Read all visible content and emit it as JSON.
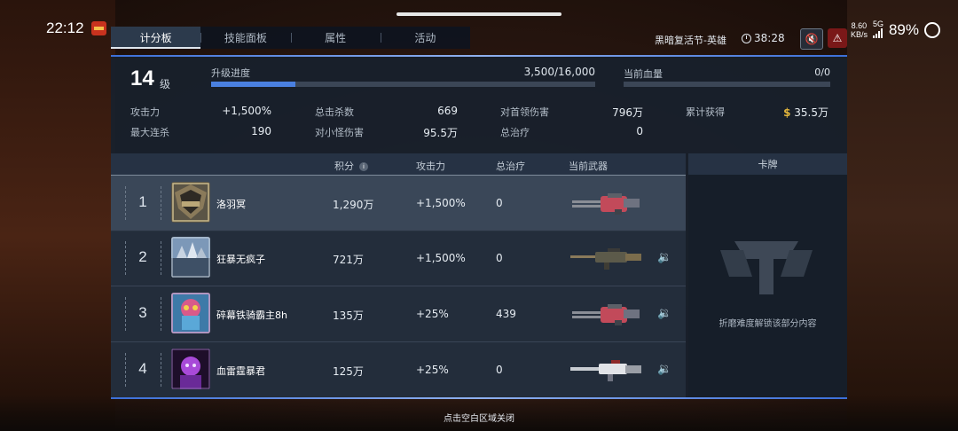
{
  "status_bar": {
    "time": "22:12",
    "net_speed_value": "8.60",
    "net_speed_unit": "KB/s",
    "network": "5G",
    "battery": "89%"
  },
  "tabs": [
    {
      "label": "计分板",
      "active": true
    },
    {
      "label": "技能面板",
      "active": false
    },
    {
      "label": "属性",
      "active": false
    },
    {
      "label": "活动",
      "active": false
    }
  ],
  "mode": "黑暗复活节-英雄",
  "timer": "38:28",
  "player": {
    "level": "14",
    "level_unit": "级",
    "upgrade_label": "升级进度",
    "upgrade_value": "3,500/16,000",
    "upgrade_progress": 0.219,
    "hp_label": "当前血量",
    "hp_value": "0/0"
  },
  "stats": [
    {
      "label": "攻击力",
      "value": "+1,500%"
    },
    {
      "label": "总击杀数",
      "value": "669"
    },
    {
      "label": "对首领伤害",
      "value": "796万"
    },
    {
      "label": "累计获得",
      "value": "35.5万"
    },
    {
      "label": "最大连杀",
      "value": "190"
    },
    {
      "label": "对小怪伤害",
      "value": "95.5万"
    },
    {
      "label": "总治疗",
      "value": "0"
    }
  ],
  "table": {
    "headers": {
      "score": "积分",
      "attack": "攻击力",
      "heal": "总治疗",
      "weapon": "当前武器",
      "cards": "卡牌"
    },
    "rows": [
      {
        "rank": "1",
        "name": "洛羽冥",
        "score": "1,290万",
        "attack": "+1,500%",
        "heal": "0"
      },
      {
        "rank": "2",
        "name": "狂暴无疯子",
        "score": "721万",
        "attack": "+1,500%",
        "heal": "0"
      },
      {
        "rank": "3",
        "name": "碎幕铁骑霸主8h",
        "score": "135万",
        "attack": "+25%",
        "heal": "439"
      },
      {
        "rank": "4",
        "name": "血雷霆暴君",
        "score": "125万",
        "attack": "+25%",
        "heal": "0"
      }
    ]
  },
  "cards_locked_text": "折磨难度解锁该部分内容",
  "close_hint": "点击空白区域关闭",
  "colors": {
    "accent_blue": "#4a80e0",
    "coin": "#e2b53c",
    "warning": "#7a1818"
  }
}
